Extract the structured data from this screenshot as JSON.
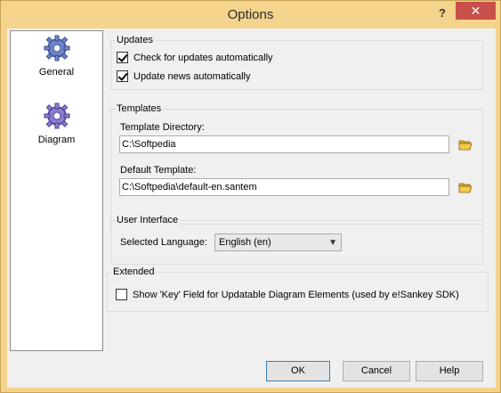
{
  "window": {
    "title": "Options",
    "help_label": "?",
    "close_label": "✕"
  },
  "sidebar": {
    "items": [
      {
        "label": "General",
        "icon": "gear-icon"
      },
      {
        "label": "Diagram",
        "icon": "gear-icon"
      }
    ]
  },
  "updates": {
    "title": "Updates",
    "check_auto": {
      "label": "Check for updates automatically",
      "checked": true
    },
    "news_auto": {
      "label": "Update news automatically",
      "checked": true
    }
  },
  "templates": {
    "title": "Templates",
    "dir_label": "Template Directory:",
    "dir_value": "C:\\Softpedia",
    "default_label": "Default Template:",
    "default_value": "C:\\Softpedia\\default-en.santem"
  },
  "ui": {
    "title": "User Interface",
    "language_label": "Selected Language:",
    "language_value": "English (en)"
  },
  "extended": {
    "title": "Extended",
    "key_field": {
      "label": "Show 'Key' Field for Updatable Diagram Elements (used by e!Sankey SDK)",
      "checked": false
    }
  },
  "buttons": {
    "ok": "OK",
    "cancel": "Cancel",
    "help": "Help"
  },
  "colors": {
    "frame": "#f4d38c",
    "close": "#c7504b",
    "client": "#f0f0f0"
  }
}
